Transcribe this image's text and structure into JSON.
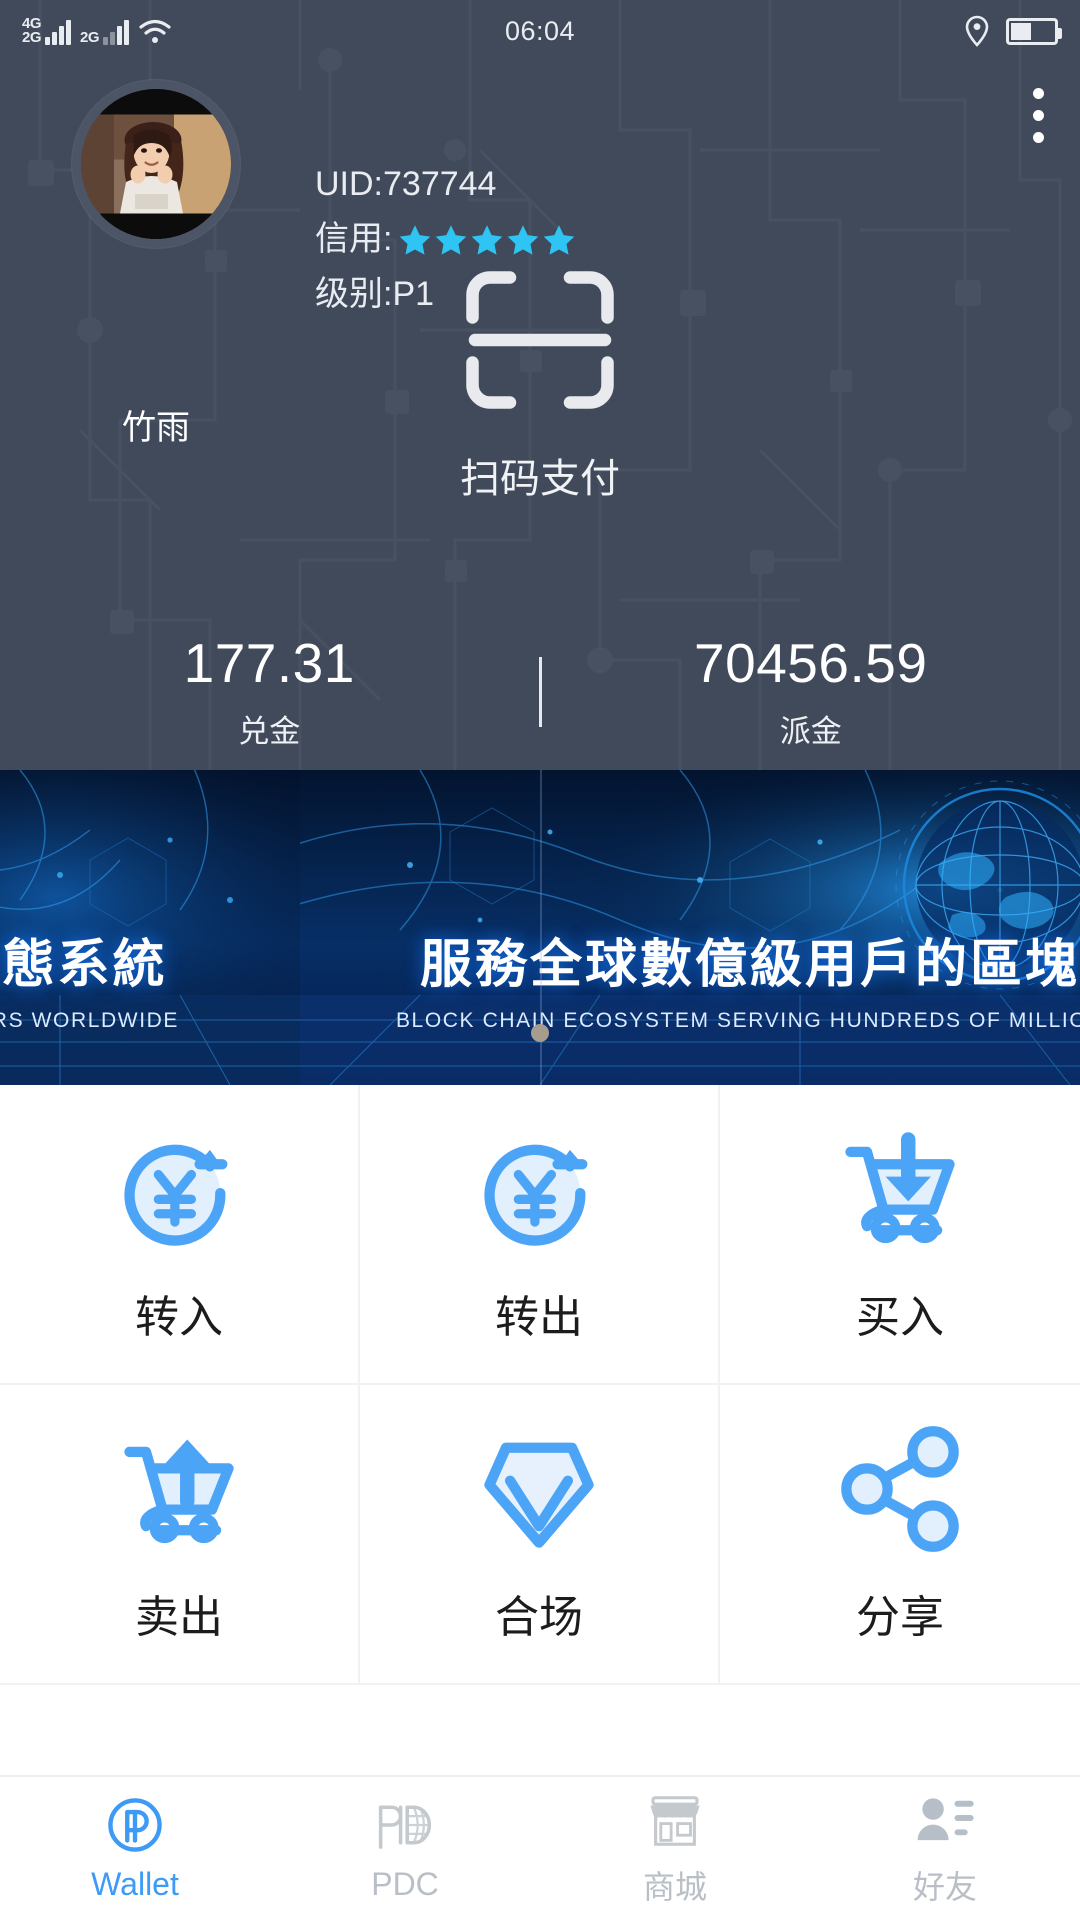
{
  "statusbar": {
    "net_primary": "4G",
    "net_primary_plus": "+",
    "net_secondary": "2G",
    "net_third": "2G",
    "wifi_icon": "wifi-icon",
    "time": "06:04",
    "location_icon": "location-pin-icon",
    "battery_icon": "battery-icon"
  },
  "header": {
    "avatar_name": "avatar",
    "username": "竹雨",
    "uid_label": "UID:737744",
    "credit_label": "信用:",
    "credit_stars": 5,
    "level_label": "级别:P1",
    "menu_icon": "overflow-menu-icon",
    "scan": {
      "icon": "scan-qr-icon",
      "label": "扫码支付"
    },
    "balances": [
      {
        "value": "177.31",
        "label": "兑金"
      },
      {
        "value": "70456.59",
        "label": "派金"
      }
    ]
  },
  "banner": {
    "slides": [
      {
        "cn": "鏈生態系統",
        "en": "S OF USERS WORLDWIDE"
      },
      {
        "cn": "服務全球數億級用戶的區塊",
        "en": "BLOCK CHAIN ECOSYSTEM SERVING HUNDREDS OF MILLION"
      }
    ],
    "active_dot": 0,
    "dot_count": 1
  },
  "grid": {
    "items": [
      {
        "label": "转入",
        "icon": "transfer-in-icon"
      },
      {
        "label": "转出",
        "icon": "transfer-out-icon"
      },
      {
        "label": "买入",
        "icon": "cart-buy-icon"
      },
      {
        "label": "卖出",
        "icon": "cart-sell-icon"
      },
      {
        "label": "合场",
        "icon": "diamond-icon"
      },
      {
        "label": "分享",
        "icon": "share-nodes-icon"
      }
    ]
  },
  "tabbar": {
    "items": [
      {
        "label": "Wallet",
        "icon": "wallet-p-logo-icon",
        "active": true
      },
      {
        "label": "PDC",
        "icon": "pdc-globe-icon",
        "active": false
      },
      {
        "label": "商城",
        "icon": "storefront-icon",
        "active": false
      },
      {
        "label": "好友",
        "icon": "friends-contact-icon",
        "active": false
      }
    ]
  },
  "colors": {
    "header_bg": "#414a5a",
    "accent_blue": "#3d9bf5",
    "star_blue": "#2ec4f3",
    "banner_bg": "#061a3d",
    "tab_inactive": "#b9bfc6"
  }
}
